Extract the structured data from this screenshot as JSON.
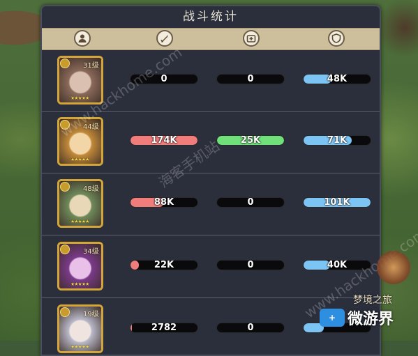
{
  "title": "战斗统计",
  "header": {
    "icons": [
      "hero-icon",
      "sword-damage-icon",
      "heal-icon",
      "shield-icon"
    ]
  },
  "colors": {
    "damage": "#f07c7c",
    "heal": "#6fe07a",
    "tank": "#7cc4f3",
    "gold_frame": "#d4a63a"
  },
  "heroes": [
    {
      "level": "31级",
      "stars": "★★★★★",
      "damage": "0",
      "heal": "0",
      "tank": "48K",
      "damage_fill": 0,
      "heal_fill": 0,
      "tank_fill": 0.42
    },
    {
      "level": "44级",
      "stars": "★★★★★",
      "damage": "174K",
      "heal": "25K",
      "tank": "71K",
      "damage_fill": 1.0,
      "heal_fill": 1.0,
      "tank_fill": 0.72
    },
    {
      "level": "48级",
      "stars": "★★★★★",
      "damage": "88K",
      "heal": "0",
      "tank": "101K",
      "damage_fill": 0.5,
      "heal_fill": 0,
      "tank_fill": 1.0
    },
    {
      "level": "34级",
      "stars": "★★★★★",
      "damage": "22K",
      "heal": "0",
      "tank": "40K",
      "damage_fill": 0.13,
      "heal_fill": 0,
      "tank_fill": 0.4
    },
    {
      "level": "19级",
      "stars": "★★★★★",
      "damage": "2782",
      "heal": "0",
      "tank": "",
      "damage_fill": 0.02,
      "heal_fill": 0,
      "tank_fill": 0.3
    }
  ],
  "watermark": "www.hackhome.com",
  "watermark_cn": "海客手机站",
  "side_label": "梦境之旅",
  "logo": {
    "icon_text": "+",
    "name": "微游界"
  }
}
